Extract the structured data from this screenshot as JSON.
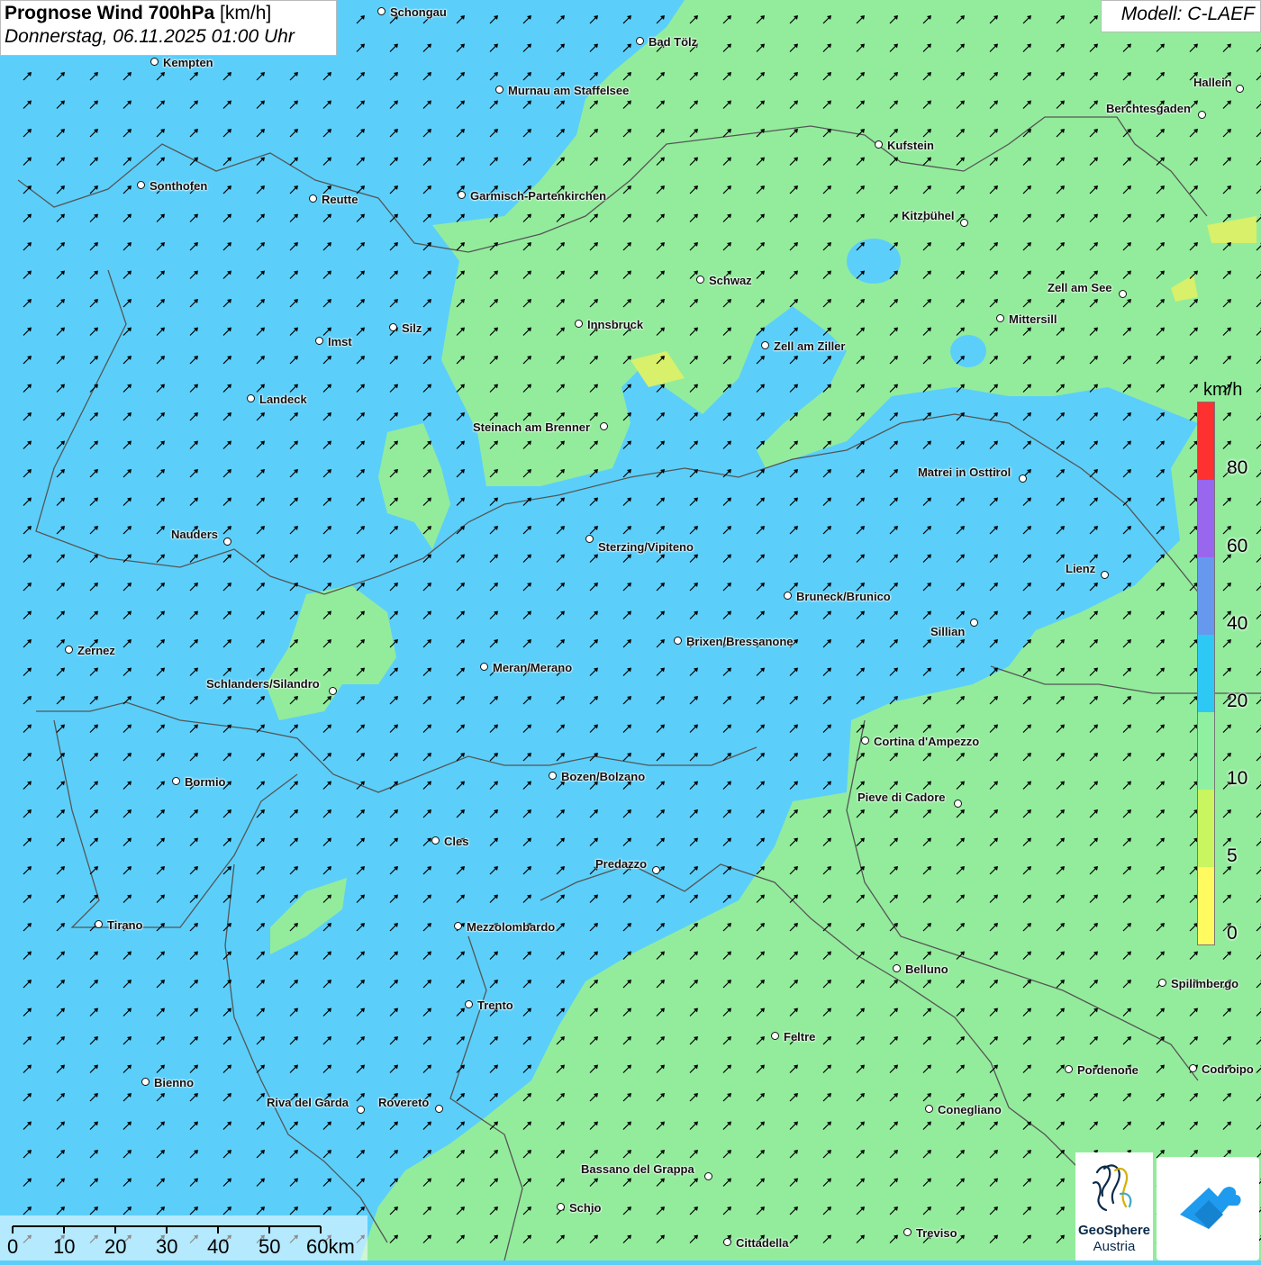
{
  "title": {
    "bold": "Prognose Wind 700hPa",
    "unit": "[km/h]",
    "date": "Donnerstag, 06.11.2025 01:00 Uhr"
  },
  "model": "Modell: C-LAEF",
  "legend": {
    "unit": "km/h",
    "labels": [
      "80",
      "60",
      "40",
      "20",
      "10",
      "5",
      "0"
    ],
    "colors": [
      "#ff3030",
      "#9966ee",
      "#6699ee",
      "#2ec8f5",
      "#8ef0a0",
      "#c8f560",
      "#fffa60"
    ]
  },
  "colors": {
    "blue_zone": "#5bcffa",
    "green_zone": "#93ec9c",
    "yellow_zone": "#d8f06a",
    "border": "#555555"
  },
  "scalebar": {
    "labels": [
      "0",
      "10",
      "20",
      "30",
      "40",
      "50",
      "60km"
    ]
  },
  "logos": {
    "geosphere_line1": "GeoSphere",
    "geosphere_line2": "Austria"
  },
  "cities": [
    {
      "name": "Schongau"
    },
    {
      "name": "Bad Tölz"
    },
    {
      "name": "Kempten"
    },
    {
      "name": "Hallein"
    },
    {
      "name": "Murnau am Staffelsee"
    },
    {
      "name": "Berchtesgaden"
    },
    {
      "name": "Kufstein"
    },
    {
      "name": "Sonthofen"
    },
    {
      "name": "Reutte"
    },
    {
      "name": "Garmisch-Partenkirchen"
    },
    {
      "name": "Kitzbühel"
    },
    {
      "name": "Schwaz"
    },
    {
      "name": "Zell am See"
    },
    {
      "name": "Innsbruck"
    },
    {
      "name": "Mittersill"
    },
    {
      "name": "Imst"
    },
    {
      "name": "Silz"
    },
    {
      "name": "Zell am Ziller"
    },
    {
      "name": "Landeck"
    },
    {
      "name": "Steinach am Brenner"
    },
    {
      "name": "Matrei in Osttirol"
    },
    {
      "name": "Nauders"
    },
    {
      "name": "Sterzing/Vipiteno"
    },
    {
      "name": "Lienz"
    },
    {
      "name": "Bruneck/Brunico"
    },
    {
      "name": "Sillian"
    },
    {
      "name": "Brixen/Bressanone"
    },
    {
      "name": "Zernez"
    },
    {
      "name": "Meran/Merano"
    },
    {
      "name": "Schlanders/Silandro"
    },
    {
      "name": "Cortina d'Ampezzo"
    },
    {
      "name": "Bozen/Bolzano"
    },
    {
      "name": "Bormio"
    },
    {
      "name": "Pieve di Cadore"
    },
    {
      "name": "Cles"
    },
    {
      "name": "Predazzo"
    },
    {
      "name": "Tirano"
    },
    {
      "name": "Mezzolombardo"
    },
    {
      "name": "Belluno"
    },
    {
      "name": "Spilimbergo"
    },
    {
      "name": "Trento"
    },
    {
      "name": "Feltre"
    },
    {
      "name": "Pordenone"
    },
    {
      "name": "Codroipo"
    },
    {
      "name": "Bienno"
    },
    {
      "name": "Riva del Garda"
    },
    {
      "name": "Rovereto"
    },
    {
      "name": "Conegliano"
    },
    {
      "name": "Bassano del Grappa"
    },
    {
      "name": "Schio"
    },
    {
      "name": "Treviso"
    },
    {
      "name": "Cittadella"
    }
  ]
}
